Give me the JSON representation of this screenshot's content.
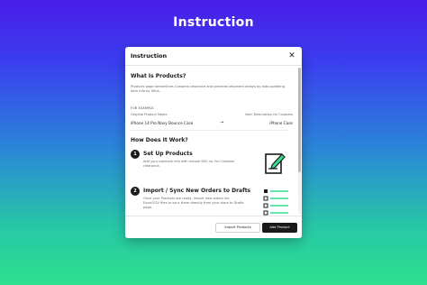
{
  "page": {
    "heading": "Instruction"
  },
  "modal": {
    "title": "Instruction",
    "close_icon": "close-icon",
    "what_title": "What Is Products?",
    "intro": "Products page streamlines Customs clearance and prevents shipment delays by auto-updating item info by SKUs.",
    "example_label": "FOR EXAMPLE:",
    "left_col_label": "Original Product Name",
    "right_col_label": "Item Description for Customs",
    "example_original": "iPhone 14 Pro Navy Bounce Case",
    "example_arrow": "→",
    "example_description": "iPhone Case",
    "how_title": "How Does It Work?",
    "steps": [
      {
        "number": "1",
        "title": "Set Up Products",
        "desc": "Add your products info with unique SKU no. for Customs clearance."
      },
      {
        "number": "2",
        "title": "Import / Sync New Orders to Drafts",
        "desc": "Once your Products are ready, import new orders via Excel/CSV files or sync them directly from your store to Drafts page."
      }
    ],
    "footer": {
      "import_label": "Import Products",
      "add_label": "Add Product"
    }
  },
  "colors": {
    "bg_top": "#4a1de8",
    "bg_bottom": "#2ee08e",
    "accent_green": "#2ee08e",
    "dark": "#1a1a1a"
  }
}
